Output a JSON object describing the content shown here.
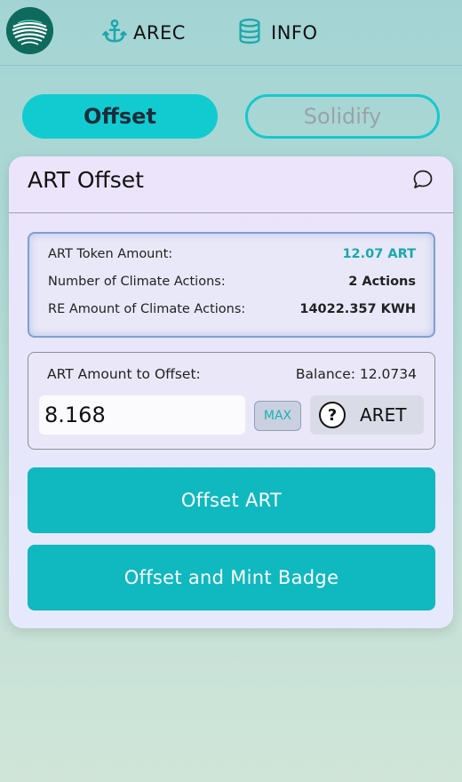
{
  "header": {
    "logo_icon": "arec-logo-icon",
    "nav": [
      {
        "label": "AREC",
        "icon": "anchor-icon"
      },
      {
        "label": "INFO",
        "icon": "database-icon"
      }
    ]
  },
  "tabs": [
    {
      "label": "Offset",
      "active": true
    },
    {
      "label": "Solidify",
      "active": false
    }
  ],
  "card": {
    "title": "ART Offset",
    "chat_icon": "chat-icon",
    "info": {
      "token_amount_label": "ART Token Amount:",
      "token_amount_value": "12.07 ART",
      "climate_actions_label": "Number of Climate Actions:",
      "climate_actions_value": "2 Actions",
      "re_amount_label": "RE Amount of Climate Actions:",
      "re_amount_value": "14022.357 KWH"
    },
    "offset": {
      "amount_label": "ART Amount to Offset:",
      "balance_label": "Balance: 12.0734",
      "amount_value": "8.168",
      "max_label": "MAX",
      "token_label": "ARET",
      "token_icon": "question-circle-icon"
    },
    "buttons": {
      "offset_art": "Offset ART",
      "offset_mint": "Offset and Mint Badge"
    }
  },
  "colors": {
    "accent": "#10b8bf",
    "tab_active": "#12cbd1",
    "teal_text": "#17a9ad"
  }
}
